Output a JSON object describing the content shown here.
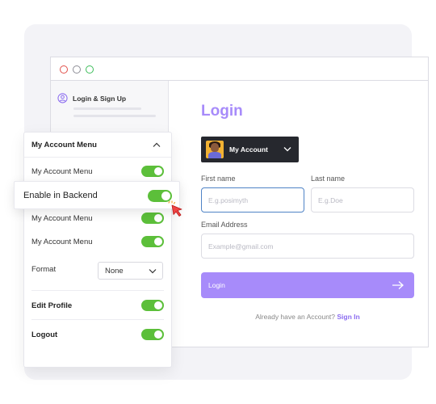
{
  "colors": {
    "accent": "#a78bfa",
    "toggle_on": "#5cbf3a",
    "account_bar": "#26282e",
    "link": "#8b6cf0"
  },
  "browser": {
    "sidebar": {
      "item_label": "Login & Sign Up",
      "item_icon": "user-circle-icon"
    },
    "login": {
      "title": "Login",
      "account_menu_label": "My Account",
      "first_name": {
        "label": "First name",
        "placeholder": "E.g.posimyth"
      },
      "last_name": {
        "label": "Last name",
        "placeholder": "E.g.Doe"
      },
      "email": {
        "label": "Email Address",
        "placeholder": "Example@gmail.com"
      },
      "submit_label": "Login",
      "already_text": "Already have an Account?",
      "signin_label": "Sign In"
    }
  },
  "panel": {
    "title": "My Account Menu",
    "rows": [
      {
        "label": "My Account Menu",
        "enabled": true
      },
      {
        "label": "Enable in Backend",
        "enabled": true
      },
      {
        "label": "My Account Menu",
        "enabled": true
      },
      {
        "label": "My Account Menu",
        "enabled": true
      }
    ],
    "format": {
      "label": "Format",
      "value": "None"
    },
    "edit_profile": {
      "label": "Edit Profile",
      "enabled": true
    },
    "logout": {
      "label": "Logout",
      "enabled": true
    }
  }
}
